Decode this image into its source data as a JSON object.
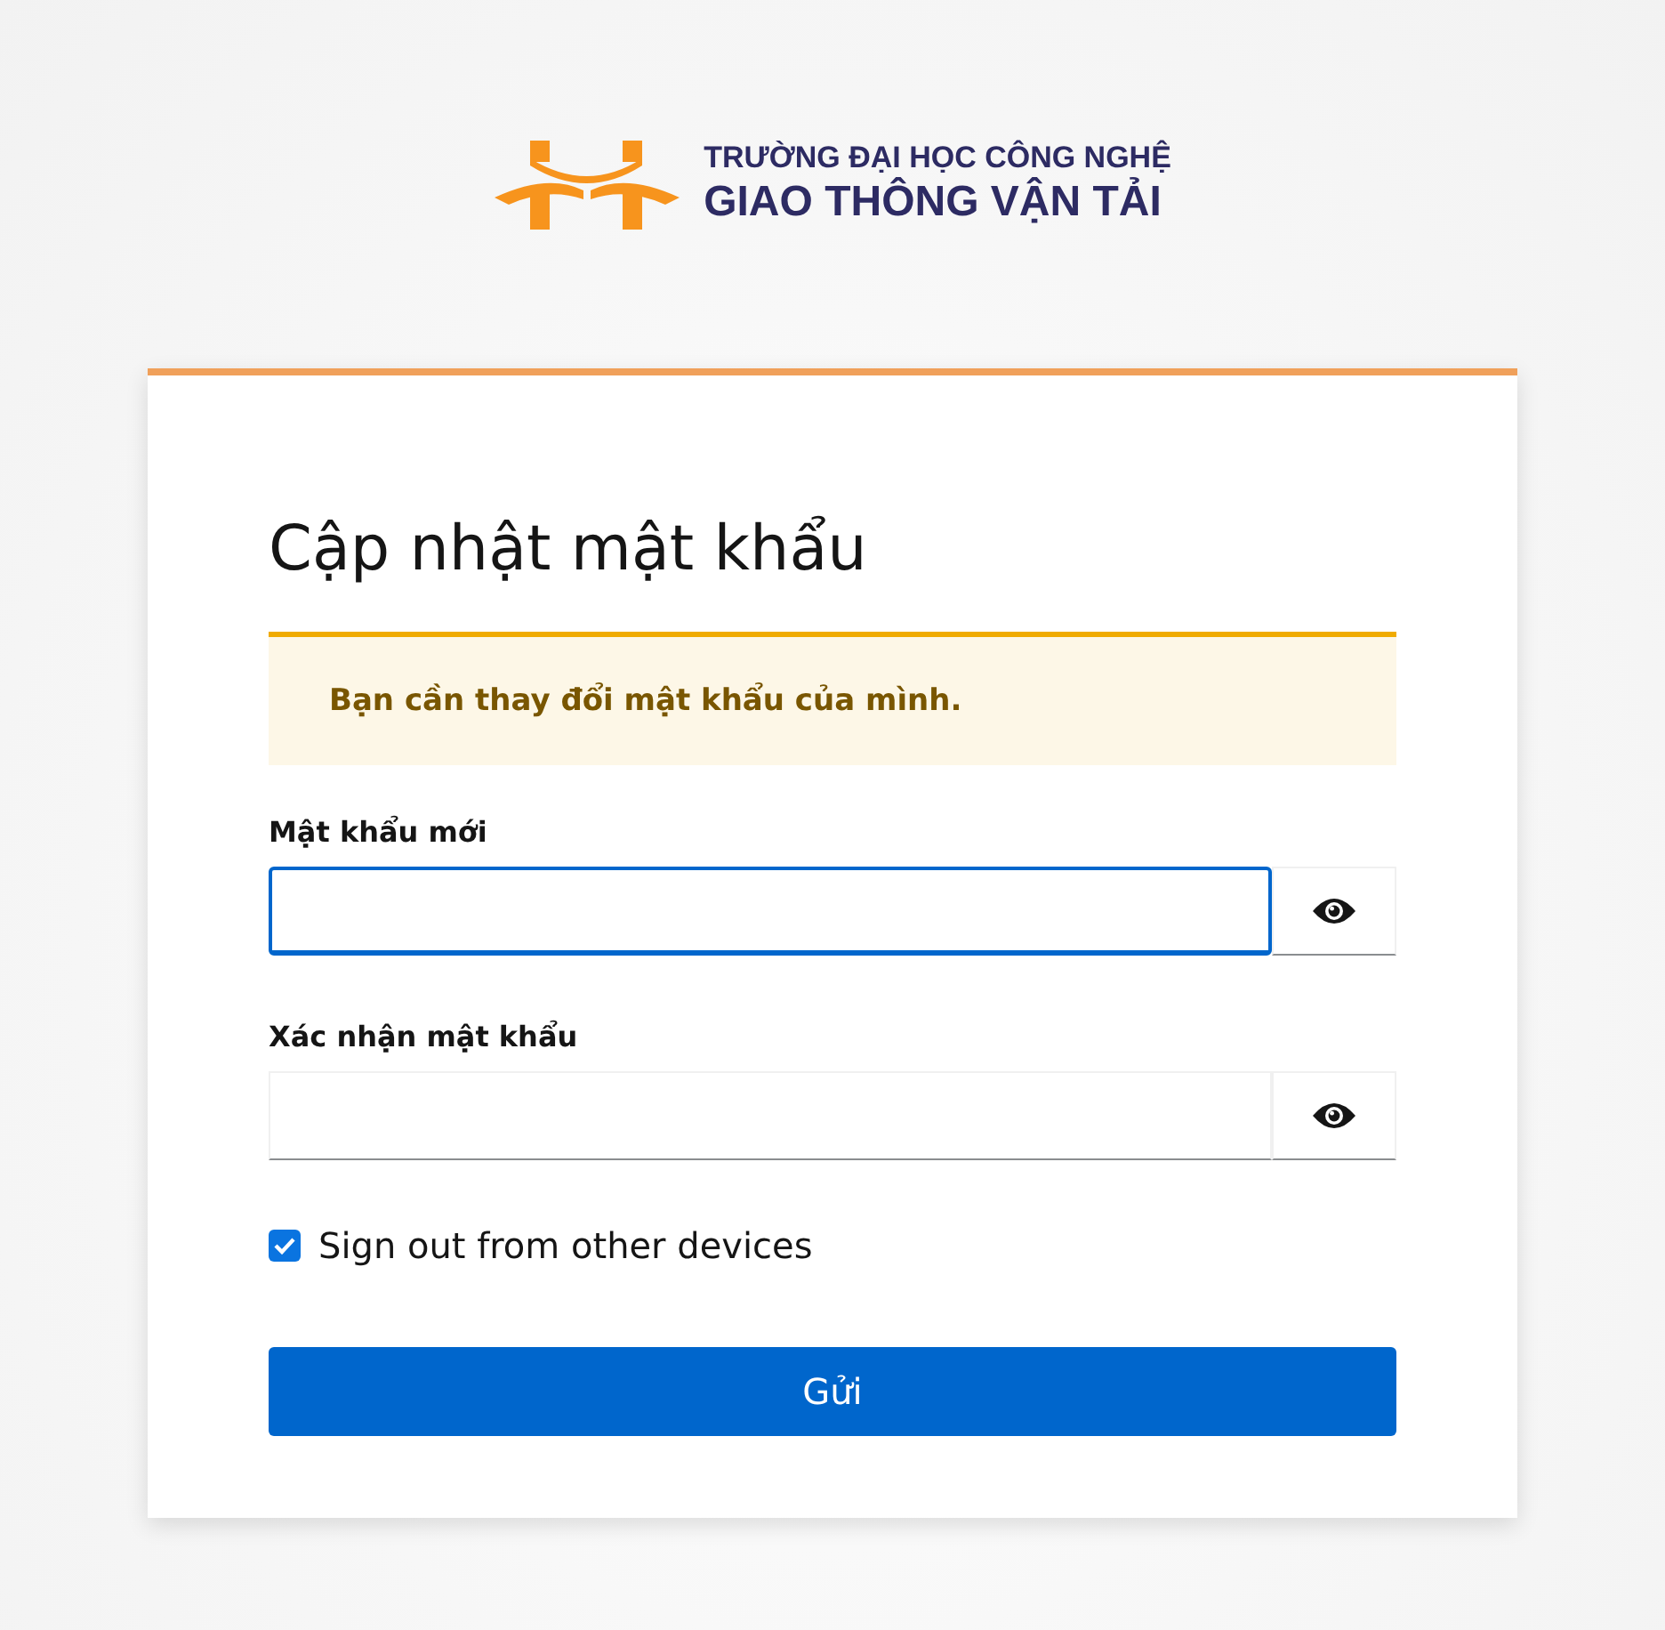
{
  "logo": {
    "line_1": "TRƯỜNG ĐẠI HỌC CÔNG NGHỆ",
    "line_2": "GIAO THÔNG VẬN TẢI"
  },
  "card": {
    "title": "Cập nhật mật khẩu",
    "alert": {
      "kind": "warning",
      "text": "Bạn cần thay đổi mật khẩu của mình."
    },
    "fields": [
      {
        "label": "Mật khẩu mới",
        "focused": true
      },
      {
        "label": "Xác nhận mật khẩu",
        "focused": false
      }
    ],
    "checkbox": {
      "label": "Sign out from other devices",
      "checked": true
    },
    "submit": "Gửi"
  }
}
